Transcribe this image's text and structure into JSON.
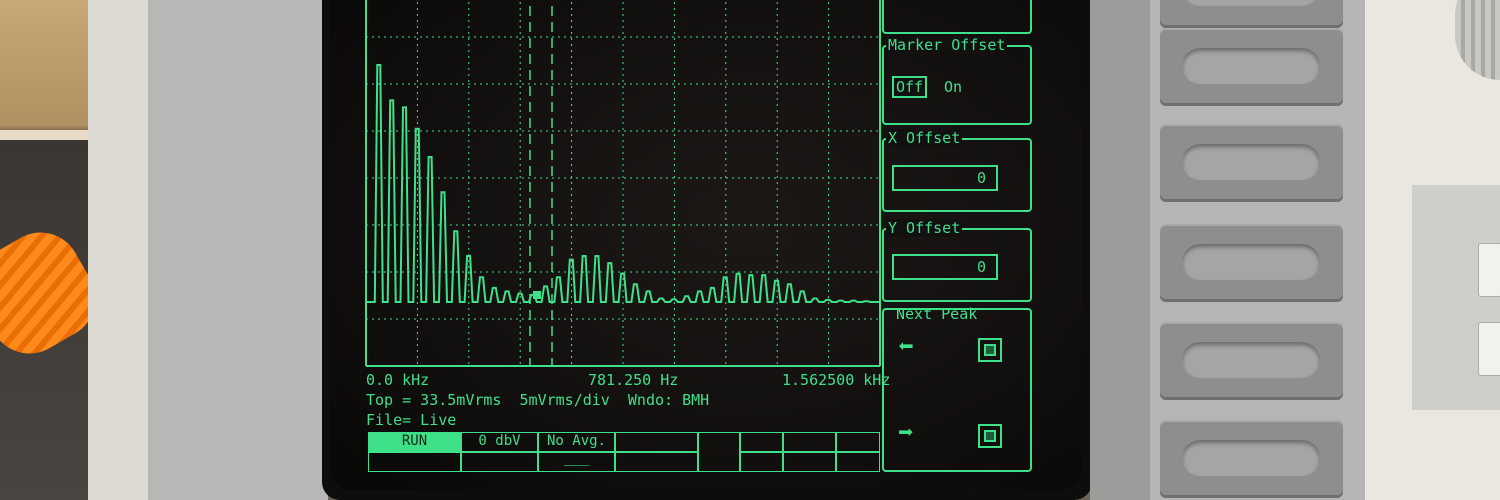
{
  "trace": {
    "x_start": "0.0 kHz",
    "x_center": "781.250 Hz",
    "x_end": "1.562500 kHz",
    "info_line": "Top = 33.5mVrms  5mVrms/div  Wndo: BMH",
    "file_line": "File= Live"
  },
  "status_bar": {
    "run": "RUN",
    "ref_level": "0 dbV",
    "averaging": "No Avg.",
    "averaging_sub": "___"
  },
  "menu": {
    "marker_offset": {
      "title": "Marker Offset",
      "off_label": "Off",
      "on_label": "On"
    },
    "x_offset": {
      "title": "X Offset",
      "value": "0"
    },
    "y_offset": {
      "title": "Y Offset",
      "value": "0"
    },
    "next_peak": {
      "title": "Next Peak",
      "left_icon": "left-arrow-icon",
      "right_icon": "right-arrow-icon"
    }
  },
  "colors": {
    "phosphor": "#3fe08a",
    "crt_background": "#100e0d"
  },
  "chart_data": {
    "type": "line",
    "x_unit": "Hz",
    "xlim": [
      0,
      1562.5
    ],
    "x_tick_labels": [
      "0.0 kHz",
      "781.250 Hz",
      "1.562500 kHz"
    ],
    "ylabel": "",
    "grid": true,
    "series": [
      {
        "peaks_x": [
          39,
          78,
          117,
          156,
          195,
          234,
          273,
          312,
          351,
          390,
          429,
          468,
          507,
          546,
          585,
          624,
          663,
          702,
          741,
          780,
          819,
          858,
          897,
          936,
          975,
          1014,
          1053,
          1092,
          1131,
          1170,
          1209,
          1248,
          1287,
          1326,
          1365,
          1404,
          1443,
          1482,
          1521
        ],
        "peaks_y": [
          33.5,
          28.5,
          27.5,
          24.5,
          20.5,
          15.5,
          10.0,
          6.5,
          3.5,
          2.0,
          1.5,
          1.2,
          1.0,
          2.2,
          3.5,
          6.0,
          6.5,
          6.5,
          5.5,
          4.0,
          2.5,
          1.5,
          0.5,
          0.4,
          0.8,
          1.5,
          2.0,
          3.5,
          4.0,
          3.8,
          3.8,
          3.0,
          2.5,
          1.5,
          0.5,
          0.3,
          0.2,
          0.2,
          0.1
        ]
      }
    ]
  }
}
